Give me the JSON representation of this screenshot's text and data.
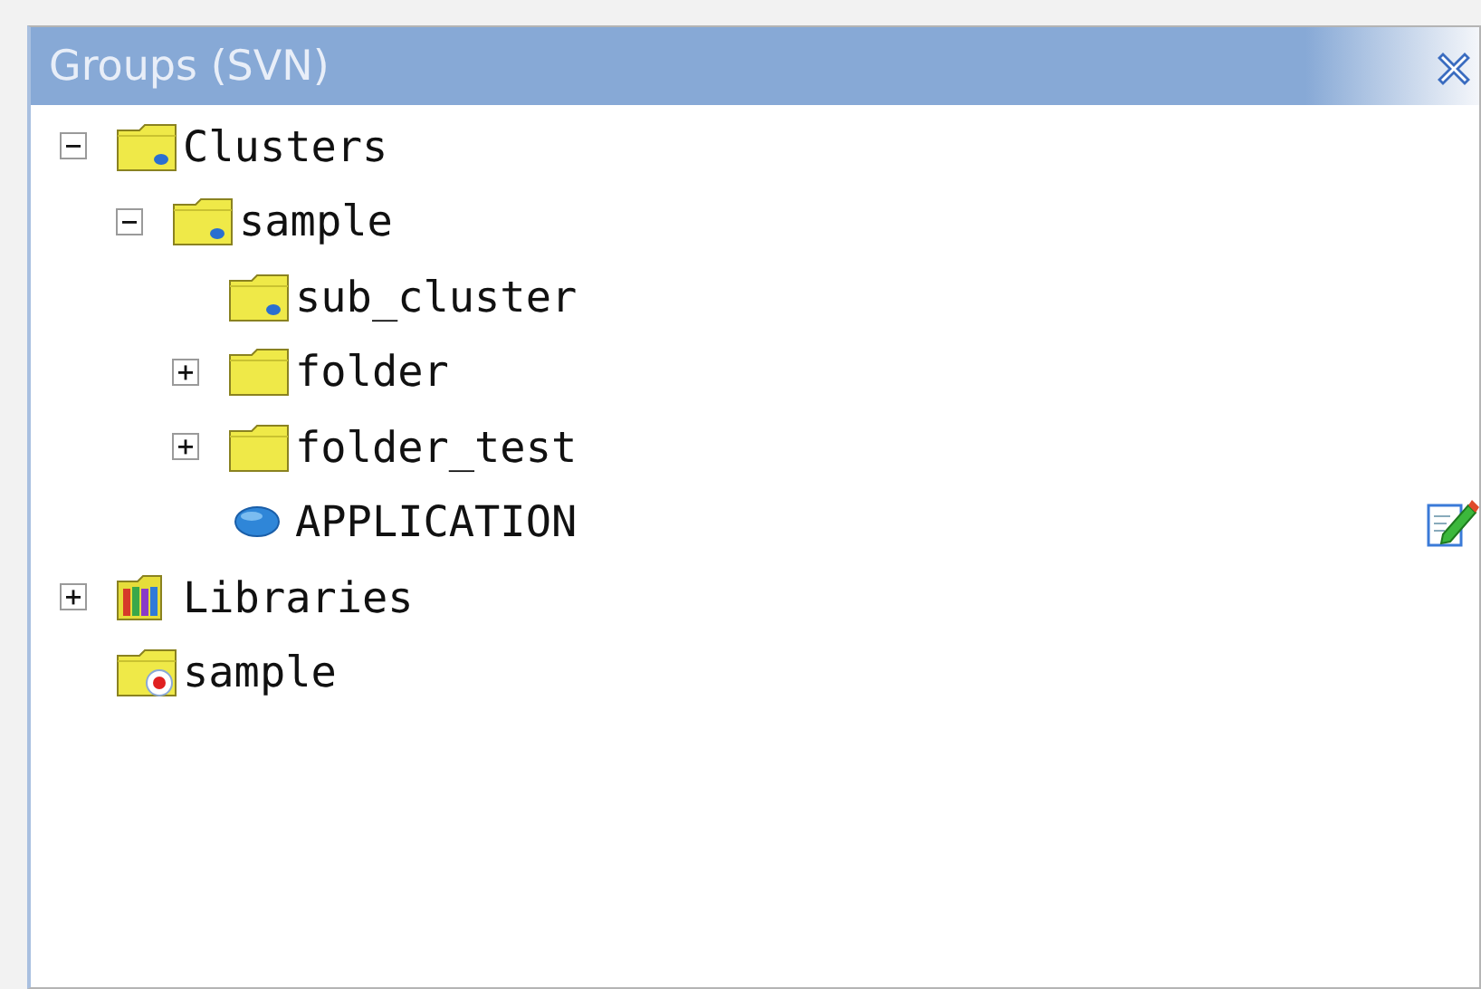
{
  "panel": {
    "title": "Groups (SVN)"
  },
  "tree": [
    {
      "label": "Clusters",
      "kind": "cluster",
      "expanded": true,
      "children": [
        {
          "label": "sample",
          "kind": "cluster",
          "expanded": true,
          "children": [
            {
              "label": "sub_cluster",
              "kind": "cluster"
            },
            {
              "label": "folder",
              "kind": "folder",
              "expanded": false
            },
            {
              "label": "folder_test",
              "kind": "folder",
              "expanded": false
            },
            {
              "label": "APPLICATION",
              "kind": "application"
            }
          ]
        }
      ]
    },
    {
      "label": "Libraries",
      "kind": "libraries",
      "expanded": false
    },
    {
      "label": "sample",
      "kind": "local"
    }
  ]
}
